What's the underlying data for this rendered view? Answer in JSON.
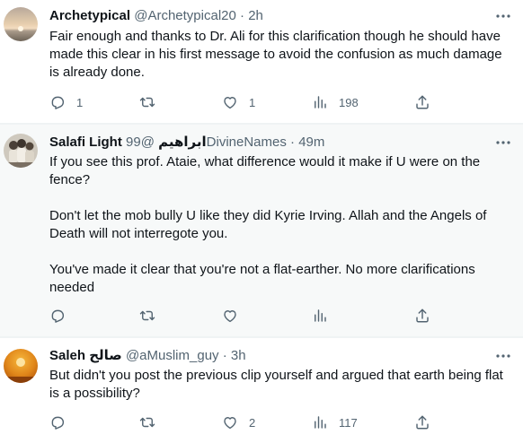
{
  "tweets": [
    {
      "name": "Archetypical",
      "handle": "@Archetypical20",
      "dot": "·",
      "time": "2h",
      "text": [
        "Fair enough and thanks to Dr. Ali for this clarification though he should have made this clear in his first message to avoid the confusion as much damage is already done."
      ],
      "replies": "1",
      "retweets": "",
      "likes": "1",
      "views": "198",
      "avatar": "sunset-horizon"
    },
    {
      "name": "Salafi Light ابراهيم",
      "handle": "@99DivineNames",
      "dot": "·",
      "time": "49m",
      "text": [
        "If you see this prof. Ataie, what difference would it make if U were on the fence?",
        "Don't let the mob bully U like they did Kyrie Irving. Allah and the Angels of Death will not interregote you.",
        "You've made it clear that you're not a flat-earther. No more clarifications needed"
      ],
      "replies": "",
      "retweets": "",
      "likes": "",
      "views": "",
      "avatar": "group-photo"
    },
    {
      "name": "Saleh صالح",
      "handle": "@aMuslim_guy",
      "dot": "·",
      "time": "3h",
      "text": [
        "But didn't you post the previous clip yourself and argued that earth being flat is a possibility?"
      ],
      "replies": "",
      "retweets": "",
      "likes": "2",
      "views": "117",
      "avatar": "orange-sun"
    }
  ],
  "icons": {
    "reply": "reply-icon",
    "retweet": "retweet-icon",
    "like": "heart-icon",
    "views": "views-icon",
    "share": "share-icon",
    "more": "more-icon"
  },
  "colors": {
    "text": "#0f1419",
    "secondary": "#536471",
    "highlight_bg": "#f7f9f9",
    "border": "#eff3f4"
  }
}
